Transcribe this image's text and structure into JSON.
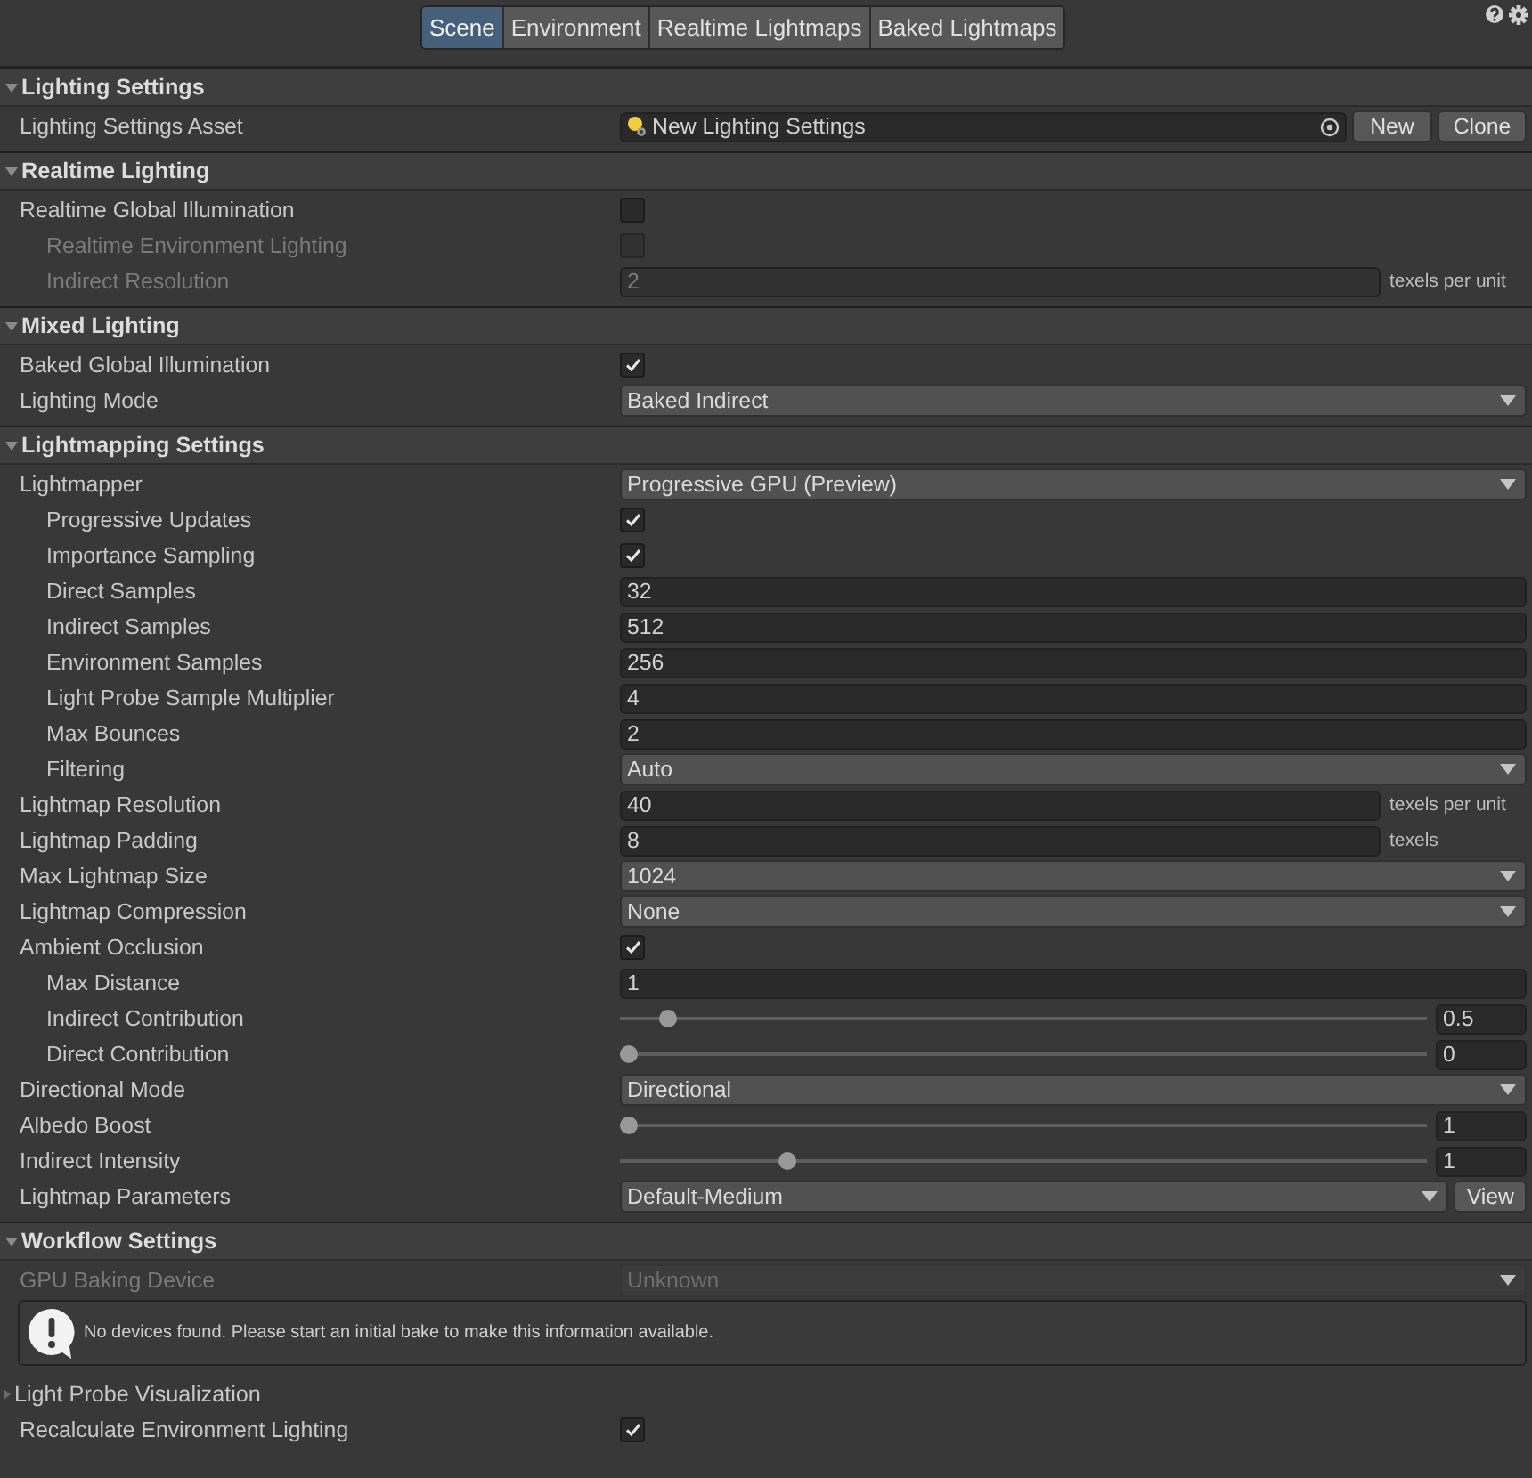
{
  "tabs": [
    {
      "label": "Scene",
      "selected": true
    },
    {
      "label": "Environment",
      "selected": false
    },
    {
      "label": "Realtime Lightmaps",
      "selected": false
    },
    {
      "label": "Baked Lightmaps",
      "selected": false
    }
  ],
  "sections": [
    {
      "title": "Lighting Settings",
      "expanded": true,
      "rows": [
        {
          "label": "Lighting Settings Asset",
          "kind": "asset",
          "disabled": false,
          "value": "New Lighting Settings",
          "buttons": [
            "New",
            "Clone"
          ]
        }
      ]
    },
    {
      "title": "Realtime Lighting",
      "expanded": true,
      "rows": [
        {
          "label": "Realtime Global Illumination",
          "kind": "checkbox",
          "disabled": false,
          "checked": false,
          "children": [
            {
              "label": "Realtime Environment Lighting",
              "kind": "checkbox",
              "disabled": true,
              "checked": false
            },
            {
              "label": "Indirect Resolution",
              "kind": "field",
              "disabled": true,
              "value": "2",
              "suffix": "texels per unit"
            }
          ]
        }
      ]
    },
    {
      "title": "Mixed Lighting",
      "expanded": true,
      "rows": [
        {
          "label": "Baked Global Illumination",
          "kind": "checkbox",
          "disabled": false,
          "checked": true
        },
        {
          "label": "Lighting Mode",
          "kind": "dropdown",
          "disabled": false,
          "value": "Baked Indirect"
        }
      ]
    },
    {
      "title": "Lightmapping Settings",
      "expanded": true,
      "rows": [
        {
          "label": "Lightmapper",
          "kind": "dropdown",
          "disabled": false,
          "value": "Progressive GPU (Preview)",
          "children": [
            {
              "label": "Progressive Updates",
              "kind": "checkbox",
              "disabled": false,
              "checked": true
            },
            {
              "label": "Importance Sampling",
              "kind": "checkbox",
              "disabled": false,
              "checked": true
            },
            {
              "label": "Direct Samples",
              "kind": "field",
              "disabled": false,
              "value": "32"
            },
            {
              "label": "Indirect Samples",
              "kind": "field",
              "disabled": false,
              "value": "512"
            },
            {
              "label": "Environment Samples",
              "kind": "field",
              "disabled": false,
              "value": "256"
            },
            {
              "label": "Light Probe Sample Multiplier",
              "kind": "field",
              "disabled": false,
              "value": "4"
            },
            {
              "label": "Max Bounces",
              "kind": "field",
              "disabled": false,
              "value": "2"
            },
            {
              "label": "Filtering",
              "kind": "dropdown",
              "disabled": false,
              "value": "Auto"
            }
          ]
        },
        {
          "label": "Lightmap Resolution",
          "kind": "field",
          "disabled": false,
          "value": "40",
          "suffix": "texels per unit"
        },
        {
          "label": "Lightmap Padding",
          "kind": "field",
          "disabled": false,
          "value": "8",
          "suffix": "texels"
        },
        {
          "label": "Max Lightmap Size",
          "kind": "dropdown",
          "disabled": false,
          "value": "1024"
        },
        {
          "label": "Lightmap Compression",
          "kind": "dropdown",
          "disabled": false,
          "value": "None"
        },
        {
          "label": "Ambient Occlusion",
          "kind": "checkbox",
          "disabled": false,
          "checked": true,
          "children": [
            {
              "label": "Max Distance",
              "kind": "field",
              "disabled": false,
              "value": "1"
            },
            {
              "label": "Indirect Contribution",
              "kind": "slider",
              "disabled": false,
              "level": 0.05,
              "value": "0.5"
            },
            {
              "label": "Direct Contribution",
              "kind": "slider",
              "disabled": false,
              "level": 0,
              "value": "0"
            }
          ]
        },
        {
          "label": "Directional Mode",
          "kind": "dropdown",
          "disabled": false,
          "value": "Directional"
        },
        {
          "label": "Albedo Boost",
          "kind": "slider",
          "disabled": false,
          "level": 0,
          "value": "1"
        },
        {
          "label": "Indirect Intensity",
          "kind": "slider",
          "disabled": false,
          "level": 0.2,
          "value": "1"
        },
        {
          "label": "Lightmap Parameters",
          "kind": "dropdown",
          "disabled": false,
          "value": "Default-Medium",
          "button": "View"
        }
      ]
    },
    {
      "title": "Workflow Settings",
      "expanded": true,
      "rows": [
        {
          "label": "GPU Baking Device",
          "kind": "dropdown",
          "disabled": true,
          "value": "Unknown"
        },
        {
          "label": "No devices found. Please start an initial bake to make this information available.",
          "kind": "help"
        }
      ]
    }
  ],
  "light_probe_foldout": {
    "label": "Light Probe Visualization",
    "expanded": false
  },
  "footer_rows": [
    {
      "label": "Recalculate Environment Lighting",
      "kind": "checkbox",
      "disabled": false,
      "checked": true
    }
  ]
}
